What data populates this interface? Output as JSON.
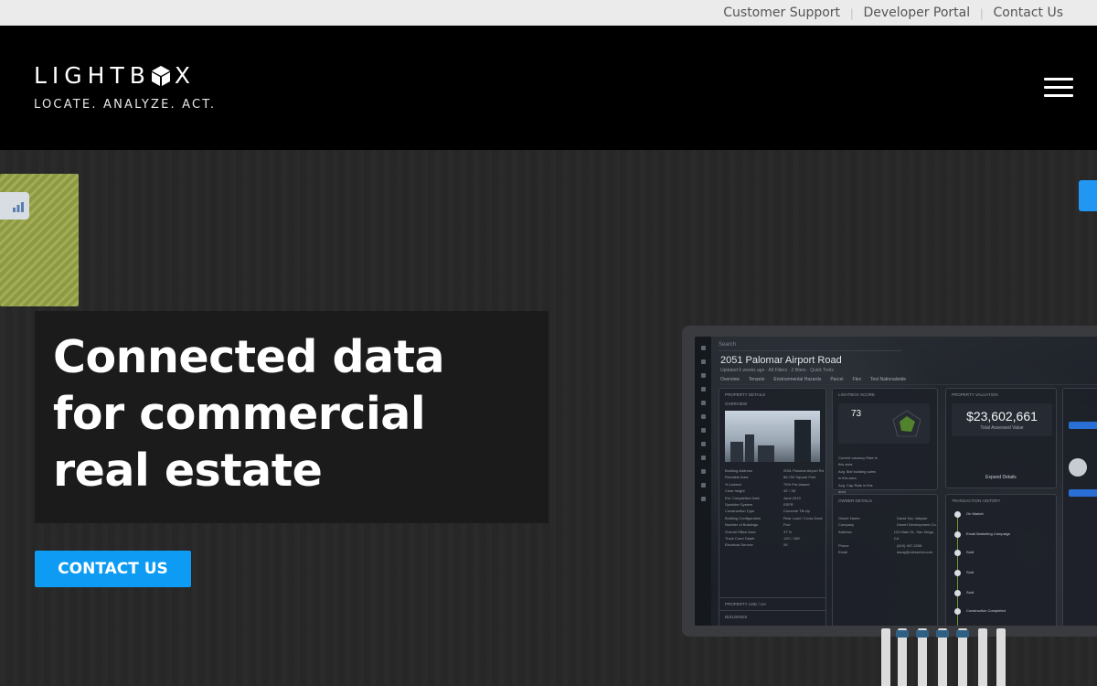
{
  "utility_nav": {
    "links": [
      "Customer Support",
      "Developer Portal",
      "Contact Us"
    ]
  },
  "header": {
    "logo_text_left": "LIGHTB",
    "logo_text_right": "X",
    "tagline": "LOCATE. ANALYZE. ACT.",
    "menu_icon": "hamburger-menu-icon"
  },
  "hero": {
    "headline": "Connected data for commercial real estate",
    "cta_label": "CONTACT US",
    "accent_color": "#0d9bf3"
  },
  "screen_mock": {
    "search_placeholder": "Search",
    "property_title": "2051 Palomar Airport Road",
    "subtitle": "Updated 6 weeks ago  ·  All Filters  ·  2 filters  ·  Quick Tools",
    "tabs": [
      "Overview",
      "Tenants",
      "Environmental Hazards",
      "Parcel",
      "Flex",
      "Test Nationalwide"
    ],
    "panel_property_details": "Property Details",
    "panel_overview": "Overview",
    "panel_lightbox_score": "LightBox Score",
    "score": "73",
    "panel_property_valuation": "Property Valuation",
    "valuation": "$23,602,661",
    "valuation_label": "Total Assessed Value",
    "panel_owner_details": "Owner Details",
    "panel_transaction_history": "Transaction History",
    "expand_label": "Expand Details",
    "property_rows": [
      [
        "Building Address",
        "2051 Palomar Airport Rd"
      ],
      [
        "Rentable Area",
        "86,750 Square Feet"
      ],
      [
        "% Leased",
        "75% Pre-leased"
      ],
      [
        "Clear height",
        "32' / 36'"
      ],
      [
        "Est. Completion Date",
        "June 2019"
      ],
      [
        "Sprinkler System",
        "ESFR"
      ],
      [
        "Construction Type",
        "Concrete Tilt-Up"
      ],
      [
        "Building Configuration",
        "Rear Load / Cross Dock"
      ],
      [
        "Number of Buildings",
        "Five"
      ],
      [
        "Overall Office Area",
        "37 %"
      ],
      [
        "Truck Court Depth",
        "120' / 185'"
      ],
      [
        "Electrical Service",
        "2K"
      ]
    ],
    "owner_rows": [
      [
        "Owner Name",
        "David Sun Jalipuer"
      ],
      [
        "Company",
        "Desert Development Co."
      ],
      [
        "Address",
        "123 Main St., San Diego, CA"
      ],
      [
        "Phone",
        "(619) 497-2298"
      ],
      [
        "Email",
        "dacsj@cdesertdv.com"
      ]
    ],
    "lower_sections": [
      "Property Use / UA",
      "Buildings"
    ],
    "timeline": [
      "On Market",
      "Email Marketing Campaign",
      "Sold",
      "Sold",
      "Sold",
      "Construction Completed"
    ]
  }
}
